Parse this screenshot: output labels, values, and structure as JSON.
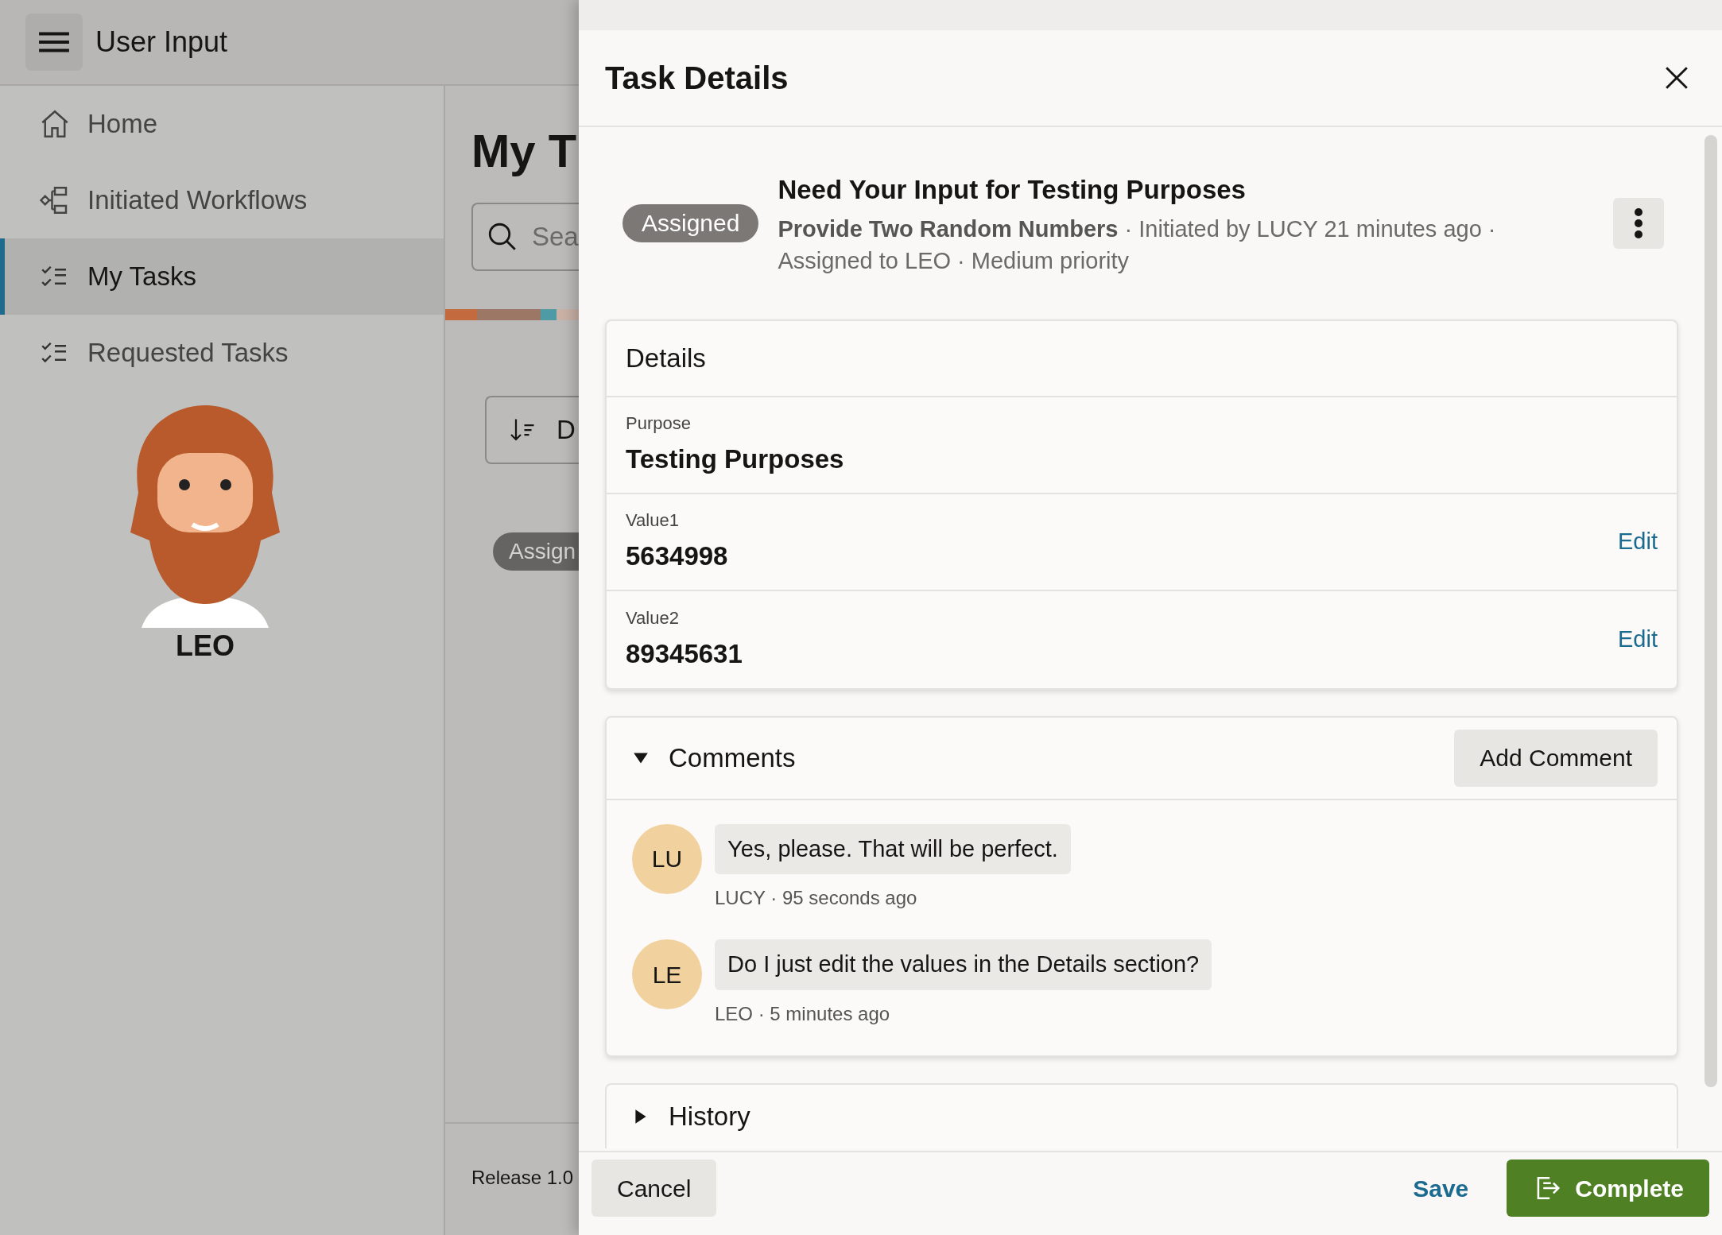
{
  "app": {
    "title": "User Input"
  },
  "sidebar": {
    "items": [
      {
        "label": "Home",
        "selected": false
      },
      {
        "label": "Initiated Workflows",
        "selected": false
      },
      {
        "label": "My Tasks",
        "selected": true
      },
      {
        "label": "Requested Tasks",
        "selected": false
      }
    ]
  },
  "user": {
    "name": "LEO"
  },
  "main": {
    "title": "My T",
    "search": {
      "placeholder": "Sea"
    },
    "sort_button": "D",
    "status_badge": "Assign",
    "footer": "Release 1.0"
  },
  "drawer": {
    "title": "Task Details",
    "task": {
      "status": "Assigned",
      "title": "Need Your Input for Testing Purposes",
      "summary": "**Provide Two Random Numbers** · Initiated by LUCY 21 minutes ago · Assigned to LEO · Medium priority"
    },
    "details": {
      "heading": "Details",
      "fields": [
        {
          "label": "Purpose",
          "value": "Testing Purposes"
        },
        {
          "label": "Value1",
          "value": "5634998",
          "edit": "Edit"
        },
        {
          "label": "Value2",
          "value": "89345631",
          "edit": "Edit"
        }
      ]
    },
    "comments": {
      "heading": "Comments",
      "expanded": true,
      "add_button": "Add Comment",
      "items": [
        {
          "initials": "LU",
          "text": "Yes, please. That will be perfect.",
          "meta": "LUCY · 95 seconds ago"
        },
        {
          "initials": "LE",
          "text": "Do I just edit the values in the Details section?",
          "meta": "LEO · 5 minutes ago"
        }
      ]
    },
    "history": {
      "heading": "History",
      "expanded": false
    },
    "footer": {
      "cancel": "Cancel",
      "save": "Save",
      "complete": "Complete"
    }
  }
}
